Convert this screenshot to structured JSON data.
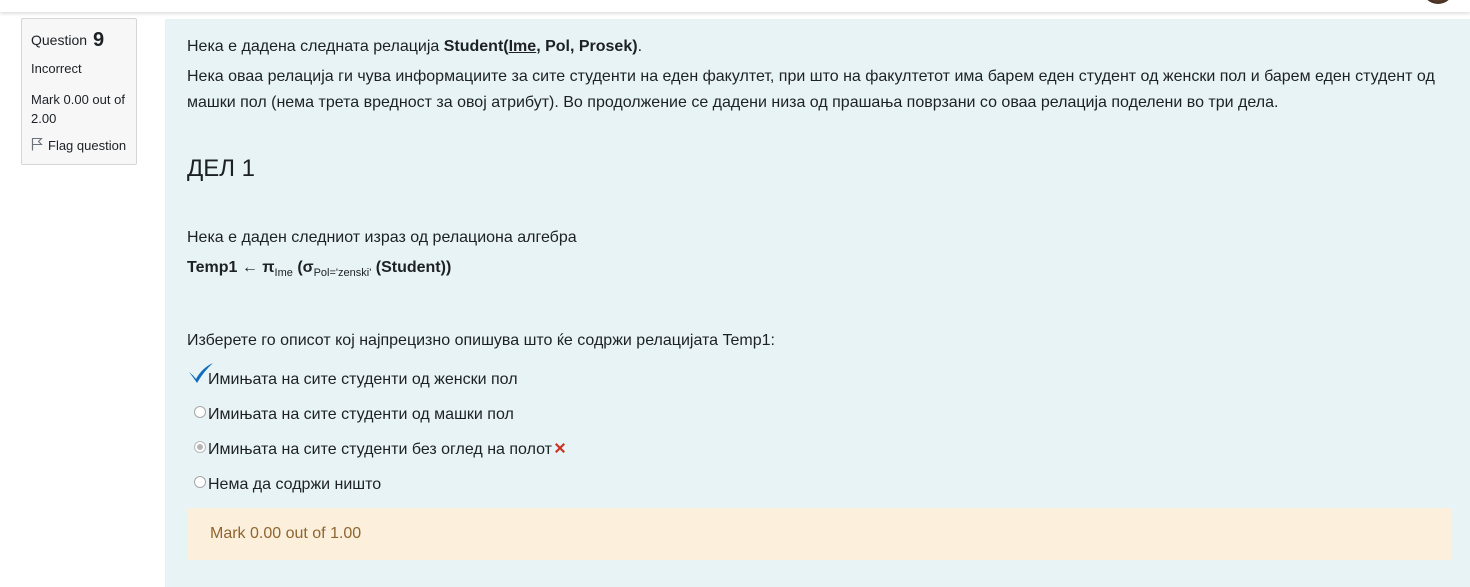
{
  "question_info": {
    "label": "Question",
    "number": "9",
    "state": "Incorrect",
    "grade": "Mark 0.00 out of 2.00",
    "flag_label": "Flag question"
  },
  "question": {
    "intro_prefix": "Нека е дадена следната релација ",
    "relation_name": "Student(",
    "relation_key": "Ime",
    "relation_rest": ", Pol, Prosek)",
    "intro_suffix": ".",
    "description": "Нека оваа релација ги чува информациите за сите студенти на еден факултет, при што на факултетот има барем еден студент од женски пол и барем еден студент од машки пол (нема трета вредност за овој атрибут). Во продолжение се дадени низа од прашања поврзани со оваа релација поделени во три дела.",
    "part_heading": "ДЕЛ 1",
    "expr_intro": "Нека е даден следниот израз од релациона алгебра",
    "expr": {
      "lhs": "Temp1 ← π",
      "pi_sub": "Ime",
      "mid": " (σ",
      "sigma_sub": "Pol='zenski'",
      "rhs": " (Student))"
    },
    "prompt": "Изберете го описот кој најпрецизно опишува што ќе содржи релацијата Temp1:"
  },
  "answers": [
    {
      "text": "Имињата на сите студенти од женски пол",
      "marker": "correct-check",
      "selected": false
    },
    {
      "text": "Имињата на сите студенти од машки пол",
      "marker": "none",
      "selected": false
    },
    {
      "text": "Имињата на сите студенти без оглед на полот",
      "marker": "incorrect-x",
      "selected": true
    },
    {
      "text": "Нема да содржи ништо",
      "marker": "none",
      "selected": false
    }
  ],
  "outcome": {
    "mark": "Mark 0.00 out of 1.00"
  },
  "colors": {
    "content_bg": "#e7f3f5",
    "outcome_bg": "#fcefdc",
    "outcome_text": "#8e662e",
    "check_blue": "#0f6cbf",
    "x_red": "#ca3120"
  }
}
